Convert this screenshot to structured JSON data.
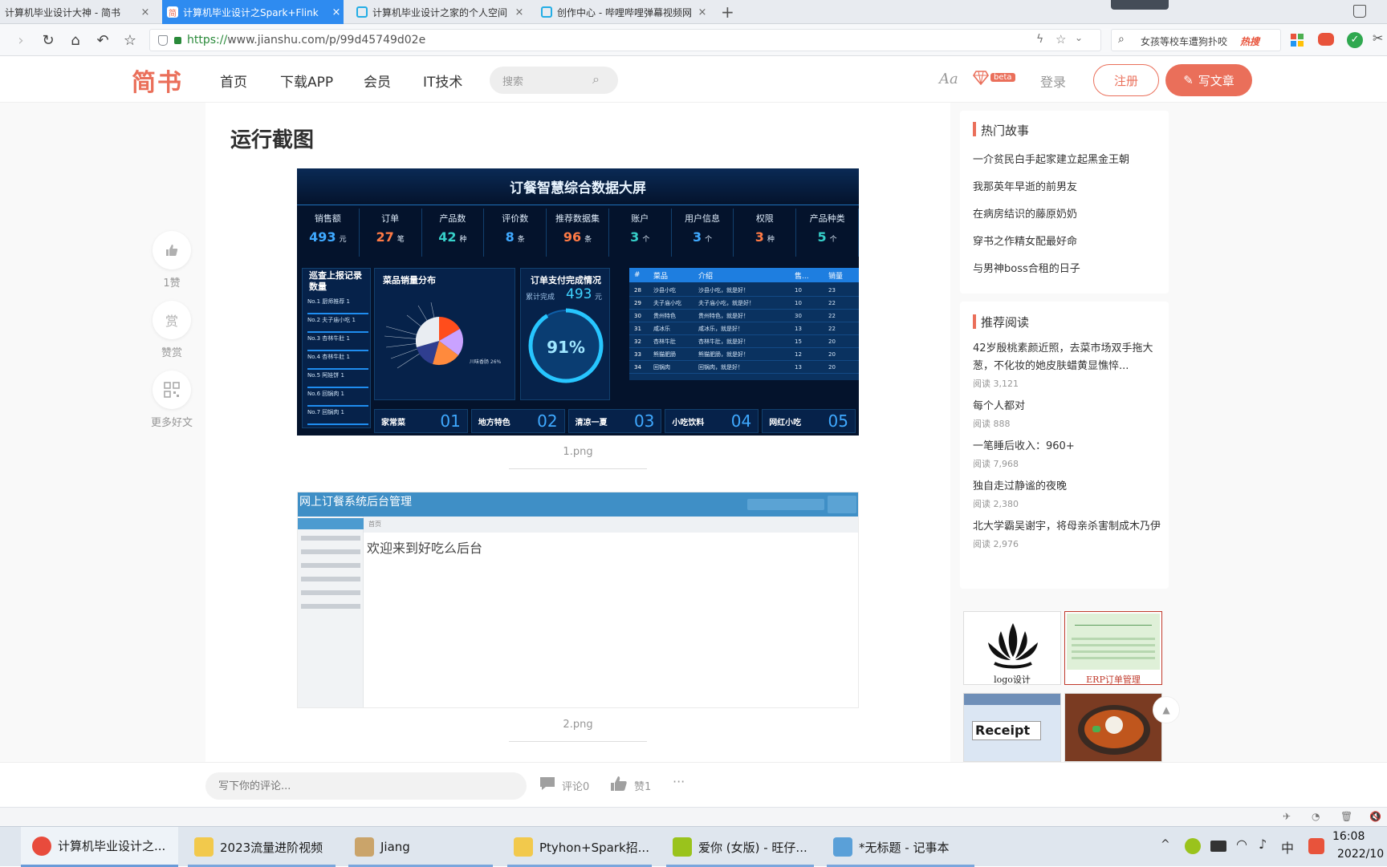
{
  "browser": {
    "tabs": [
      {
        "title": "计算机毕业设计大神 - 简书",
        "active": false,
        "fav_color": "#f5f5f5"
      },
      {
        "title": "计算机毕业设计之Spark+Flink",
        "active": true,
        "fav_color": "#ea6f5a",
        "fav_text": "简"
      },
      {
        "title": "计算机毕业设计之家的个人空间",
        "active": false,
        "fav_color": "#23ade5"
      },
      {
        "title": "创作中心 - 哔哩哔哩弹幕视频网",
        "active": false,
        "fav_color": "#23ade5"
      }
    ],
    "new_tab_glyph": "+",
    "close_glyph": "×",
    "url_proto": "https://",
    "url_rest": "www.jianshu.com/p/99d45749d02e",
    "search_text": "女孩等校车遭狗扑咬",
    "search_badge": "热搜"
  },
  "site": {
    "logo": "简书",
    "nav": [
      "首页",
      "下载APP",
      "会员",
      "IT技术"
    ],
    "search_placeholder": "搜索",
    "font_toggle": "Aa",
    "beta_label": "beta",
    "login": "登录",
    "register": "注册",
    "write": "写文章"
  },
  "rail": {
    "like_count": "1赞",
    "reward": "赞赏",
    "reward_glyph": "赏",
    "more": "更多好文"
  },
  "article": {
    "section_title": "运行截图",
    "caption1": "1.png",
    "caption2": "2.png",
    "dashboard": {
      "title": "订餐智慧综合数据大屏",
      "kpis": [
        {
          "label": "销售额",
          "value": "493",
          "unit": "元",
          "color": "#3fa9ff"
        },
        {
          "label": "订单",
          "value": "27",
          "unit": "笔",
          "color": "#ff7a45"
        },
        {
          "label": "产品数",
          "value": "42",
          "unit": "种",
          "color": "#36cfc9"
        },
        {
          "label": "评价数",
          "value": "8",
          "unit": "条",
          "color": "#3fa9ff"
        },
        {
          "label": "推荐数据集",
          "value": "96",
          "unit": "条",
          "color": "#ff7a45"
        },
        {
          "label": "账户",
          "value": "3",
          "unit": "个",
          "color": "#36cfc9"
        },
        {
          "label": "用户信息",
          "value": "3",
          "unit": "个",
          "color": "#3fa9ff"
        },
        {
          "label": "权限",
          "value": "3",
          "unit": "种",
          "color": "#ff7a45"
        },
        {
          "label": "产品种类",
          "value": "5",
          "unit": "个",
          "color": "#36cfc9"
        }
      ],
      "panel_left_title": "巡查上报记录数量",
      "left_items": [
        "厨师推荐",
        "夫子庙小吃",
        "杏林牛肚",
        "杏林牛肚",
        "阿娃饼",
        "回锅肉",
        "回锅肉"
      ],
      "pie_title": "菜品销量分布",
      "pie_note": "川味香肠 26%",
      "gauge_title": "订单支付完成情况",
      "gauge_sub_label": "累计完成",
      "gauge_value": "493",
      "gauge_unit": "元",
      "gauge_percent": "91%",
      "gauge_fraction": 0.91,
      "table_headers": [
        "#",
        "菜品",
        "介绍",
        "售...",
        "销量"
      ],
      "table_rows": [
        [
          "28",
          "沙县小吃",
          "沙县小吃，就是好！",
          "10",
          "23"
        ],
        [
          "29",
          "夫子庙小吃",
          "夫子庙小吃，就是好！",
          "10",
          "22"
        ],
        [
          "30",
          "贵州特色",
          "贵州特色，就是好！",
          "30",
          "22"
        ],
        [
          "31",
          "咸冰乐",
          "咸冰乐，就是好！",
          "13",
          "22"
        ],
        [
          "32",
          "杏林牛肚",
          "杏林牛肚，就是好！",
          "15",
          "20"
        ],
        [
          "33",
          "熊猫肥肠",
          "熊猫肥肠，就是好！",
          "12",
          "20"
        ],
        [
          "34",
          "回锅肉",
          "回锅肉，就是好！",
          "13",
          "20"
        ]
      ],
      "bottom_tabs": [
        {
          "label": "家常菜",
          "num": "01"
        },
        {
          "label": "地方特色",
          "num": "02"
        },
        {
          "label": "清凉一夏",
          "num": "03"
        },
        {
          "label": "小吃饮料",
          "num": "04"
        },
        {
          "label": "网红小吃",
          "num": "05"
        }
      ]
    },
    "admin": {
      "title": "网上订餐系统后台管理",
      "welcome": "欢迎来到好吃么后台",
      "breadcrumb": "首页"
    }
  },
  "sidebar": {
    "hot_title": "热门故事",
    "hot_items": [
      "一介贫民白手起家建立起黑金王朝",
      "我那英年早逝的前男友",
      "在病房结识的藤原奶奶",
      "穿书之作精女配最好命",
      "与男神boss合租的日子"
    ],
    "rec_title": "推荐阅读",
    "rec_items": [
      {
        "title": "42岁殷桃素颜近照，去菜市场双手拖大葱，不化妆的她皮肤蜡黄显憔悴...",
        "reads": "阅读 3,121"
      },
      {
        "title": "每个人都对",
        "reads": "阅读 888"
      },
      {
        "title": "一笔睡后收入：960+",
        "reads": "阅读 7,968"
      },
      {
        "title": "独自走过静谧的夜晚",
        "reads": "阅读 2,380"
      },
      {
        "title": "北大学霸吴谢宇，将母亲杀害制成木乃伊",
        "reads": "阅读 2,976"
      }
    ],
    "ads": [
      {
        "label": "logo设计",
        "color": "#222"
      },
      {
        "label": "ERP订单管理",
        "color": "#c0392b"
      },
      {
        "label": "Receipt",
        "color": "#1a1a1a"
      }
    ]
  },
  "comment": {
    "placeholder": "写下你的评论...",
    "comments": "评论0",
    "likes": "赞1",
    "more": "···"
  },
  "taskbar": {
    "items": [
      {
        "label": "计算机毕业设计之...",
        "icon_color": "#e84b3c",
        "active": true
      },
      {
        "label": "2023流量进阶视频",
        "icon_color": "#f2c94c",
        "active": false
      },
      {
        "label": "Jiang",
        "icon_color": "#caa46a",
        "active": false
      },
      {
        "label": "Ptyhon+Spark招...",
        "icon_color": "#f2c94c",
        "active": false
      },
      {
        "label": "爱你 (女版) - 旺仔...",
        "icon_color": "#9ac31c",
        "active": false
      },
      {
        "label": "*无标题 - 记事本",
        "icon_color": "#5aa0d8",
        "active": false
      }
    ],
    "ime": "中",
    "time": "16:08",
    "date": "2022/10"
  }
}
